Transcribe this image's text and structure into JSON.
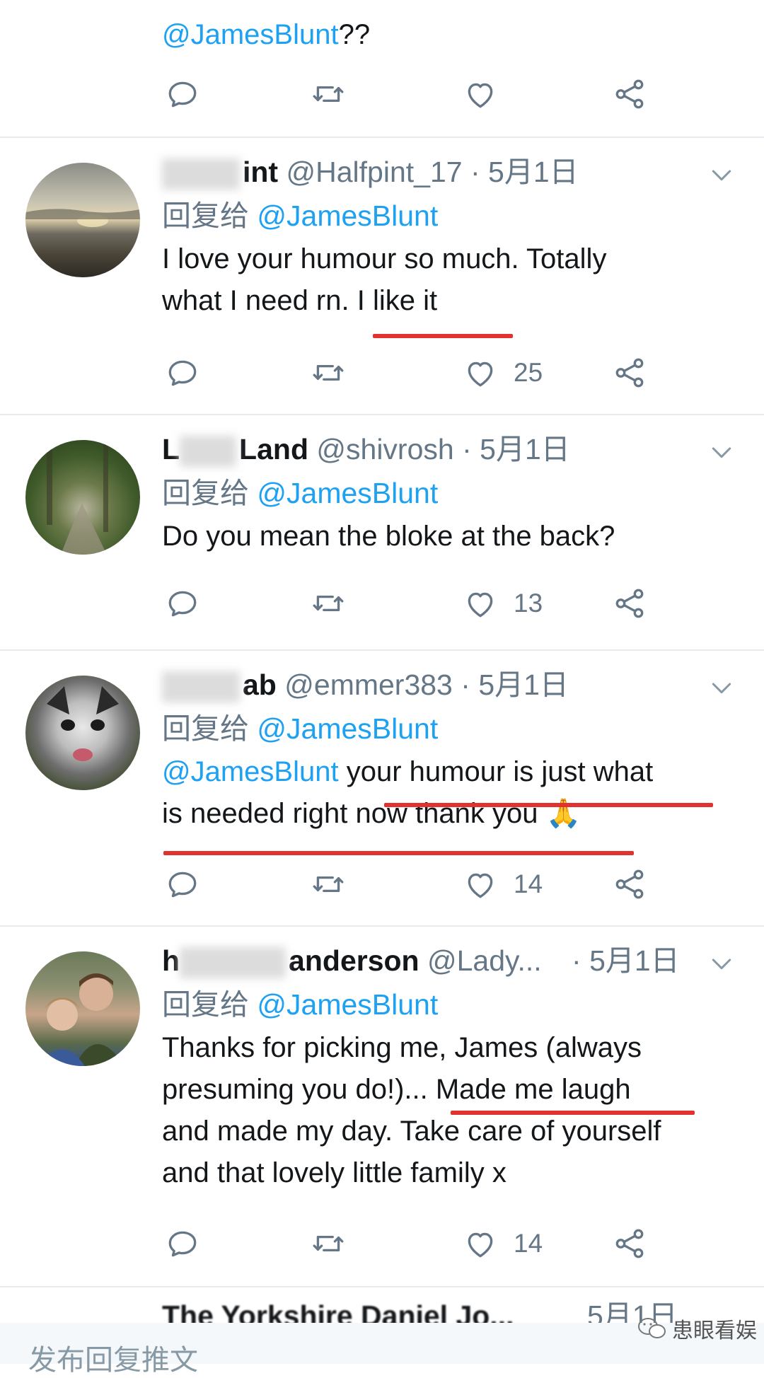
{
  "top_tweet": {
    "text_mention": "@JamesBlunt",
    "text_suffix": "??"
  },
  "reply_prefix": "回复给",
  "reply_mention": "@JamesBlunt",
  "sep": "·",
  "tweets": [
    {
      "name_visible": "int",
      "handle": "@Halfpint_17",
      "date": "5月1日",
      "body_lines": [
        "I love your humour so much. Totally",
        "what I need rn. I like it"
      ],
      "likes": "25"
    },
    {
      "name_prefix": "L",
      "name_visible": "Land",
      "handle": "@shivrosh",
      "date": "5月1日",
      "body_lines": [
        "Do you mean the bloke at the back?"
      ],
      "likes": "13"
    },
    {
      "name_visible": "ab",
      "handle": "@emmer383",
      "date": "5月1日",
      "body_mention": "@JamesBlunt",
      "body_line1_rest": " your humour is just what",
      "body_line2": "is needed right now thank you",
      "emoji": "🙏",
      "likes": "14"
    },
    {
      "name_prefix": "h",
      "name_visible": "anderson",
      "handle": "@Lady...",
      "date": "5月1日",
      "body_lines": [
        "Thanks for picking me, James (always",
        "presuming you do!)... Made me laugh",
        "and made my day. Take care of yourself",
        "and that lovely little family x"
      ],
      "likes": "14"
    }
  ],
  "next_tweet": {
    "name_partial": "The Yorkshire Daniel Jo...",
    "date_partial": "5月1日"
  },
  "footer": {
    "input_placeholder": "发布回复推文"
  },
  "watermark": {
    "text": "患眼看娱"
  },
  "icons": [
    "reply-icon",
    "retweet-icon",
    "like-icon",
    "share-icon",
    "chevron-down-icon"
  ],
  "colors": {
    "accent": "#1da1f2",
    "secondary_text": "#657786",
    "underline": "#e0332f",
    "divider": "#e6ecf0"
  }
}
